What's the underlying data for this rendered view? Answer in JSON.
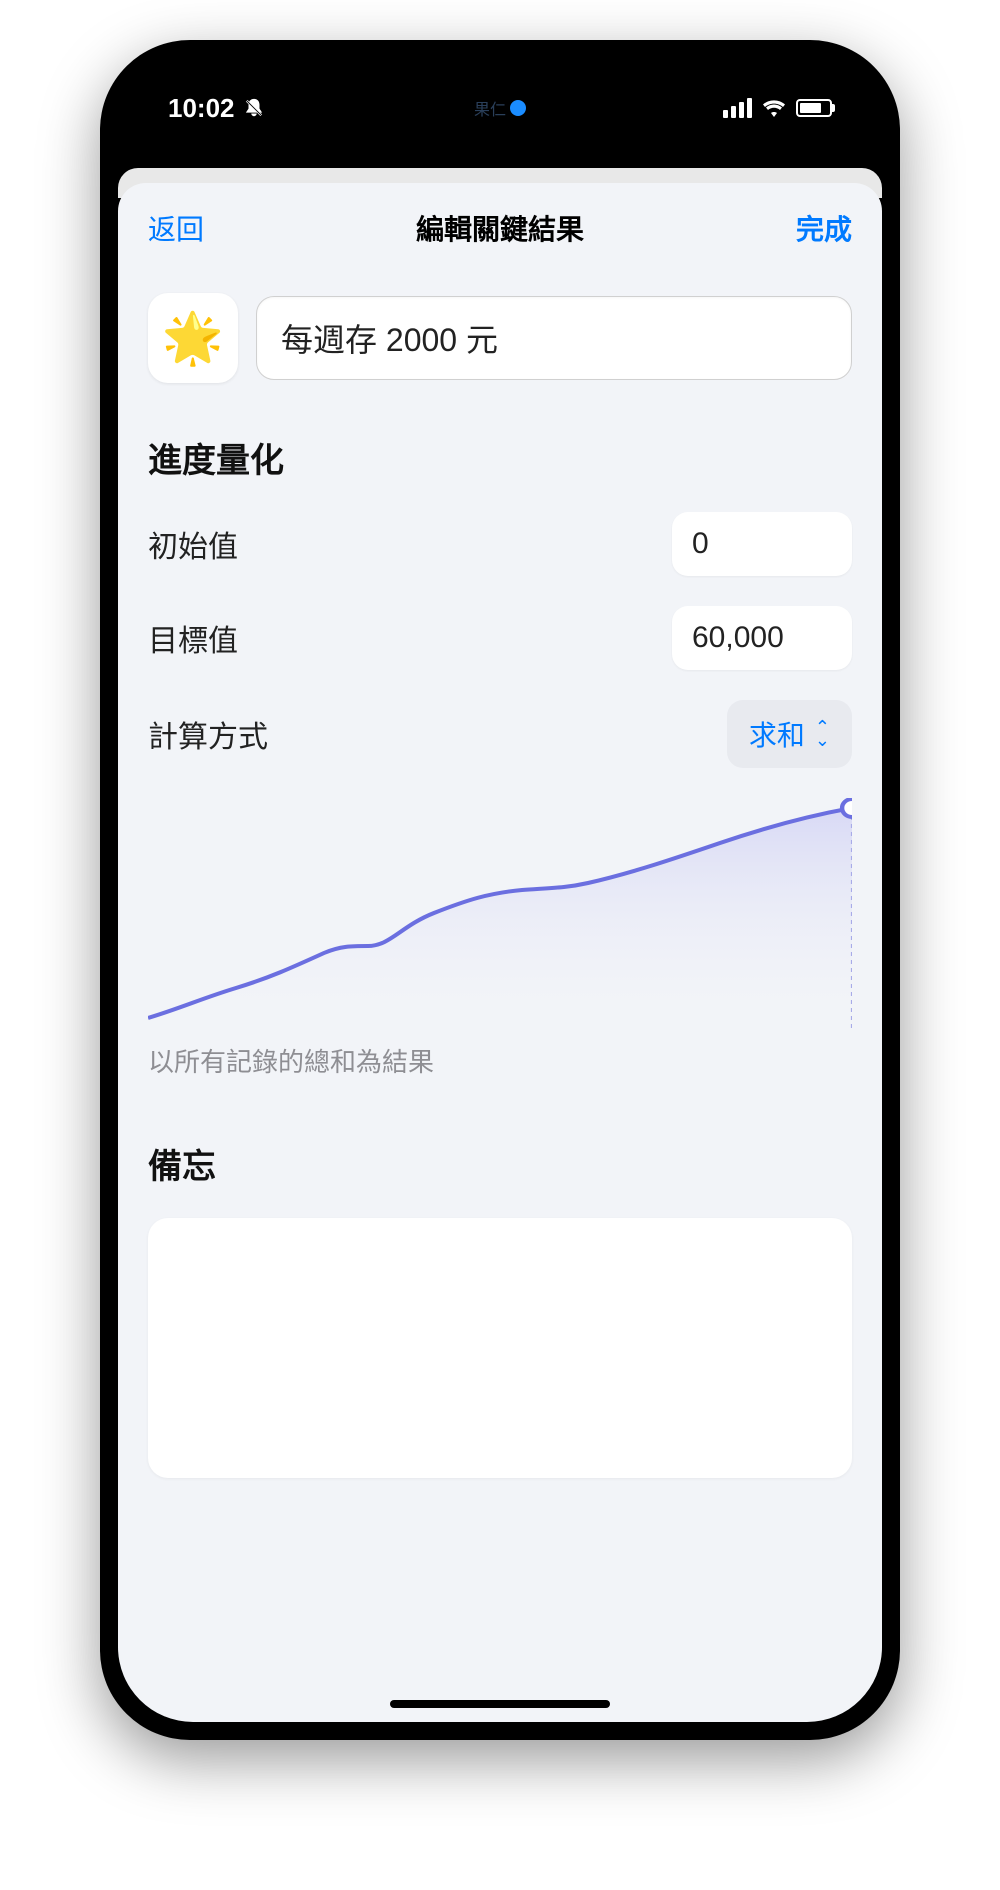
{
  "status": {
    "time": "10:02",
    "island_text": "果仁"
  },
  "nav": {
    "back": "返回",
    "title": "編輯關鍵結果",
    "done": "完成"
  },
  "key_result": {
    "icon": "🌟",
    "title": "每週存 2000 元"
  },
  "progress": {
    "section_title": "進度量化",
    "initial_label": "初始值",
    "initial_value": "0",
    "target_label": "目標值",
    "target_value": "60,000",
    "calc_label": "計算方式",
    "calc_value": "求和",
    "chart_caption": "以所有記錄的總和為結果"
  },
  "notes": {
    "section_title": "備忘"
  },
  "chart_data": {
    "type": "area",
    "x": [
      0,
      1,
      2,
      3,
      4,
      5,
      6,
      7,
      8,
      9,
      10,
      11,
      12
    ],
    "values": [
      2,
      6,
      10,
      13,
      15,
      18,
      18.5,
      22,
      27,
      27.5,
      32,
      38,
      45
    ],
    "ylim": [
      0,
      50
    ],
    "stroke": "#6b6fe0",
    "fill_top": "#d8d9f5",
    "fill_bottom": "#f2f4f8"
  }
}
